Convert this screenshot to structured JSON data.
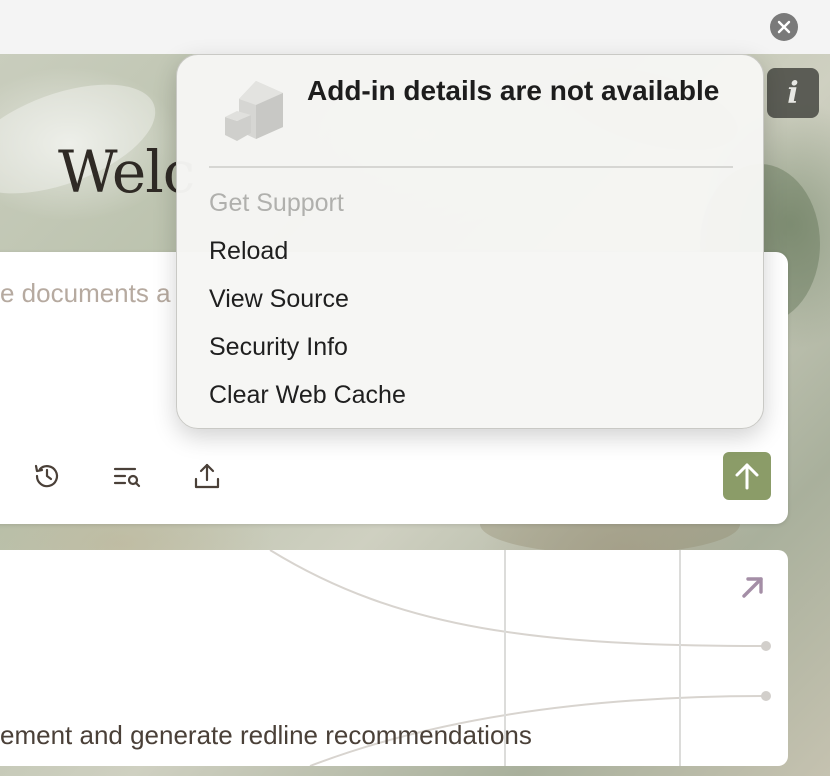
{
  "window": {
    "close_icon": "close-circle-icon"
  },
  "page": {
    "welcome_text": "Welc",
    "input_placeholder": "e documents a",
    "toolbar": {
      "history_icon": "history-icon",
      "search_list_icon": "list-search-icon",
      "upload_icon": "upload-icon",
      "send_icon": "arrow-up-icon"
    },
    "card_text": "ement and generate redline recommendations",
    "card_link_icon": "arrow-up-right-icon"
  },
  "info_button": {
    "label": "i"
  },
  "context_menu": {
    "title": "Add-in details are not available",
    "items": [
      {
        "label": "Get Support",
        "enabled": false
      },
      {
        "label": "Reload",
        "enabled": true
      },
      {
        "label": "View Source",
        "enabled": true
      },
      {
        "label": "Security Info",
        "enabled": true
      },
      {
        "label": "Clear Web Cache",
        "enabled": true
      }
    ]
  },
  "colors": {
    "accent_green": "#8b9c68",
    "link_purple": "#a48ea6"
  }
}
